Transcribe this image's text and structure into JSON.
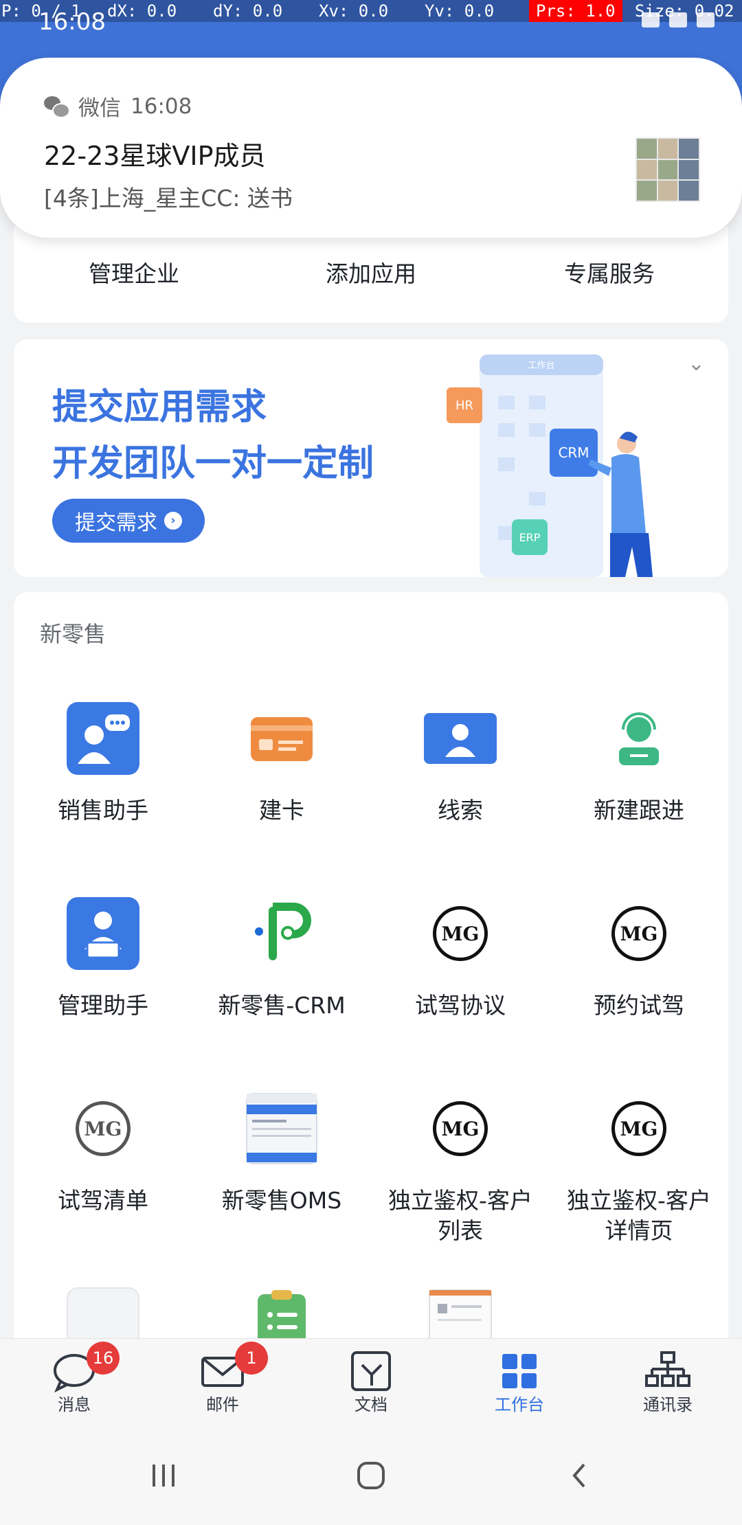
{
  "debug": {
    "p": "P: 0 / 1",
    "dx": "dX: 0.0",
    "dy": "dY: 0.0",
    "xv": "Xv: 0.0",
    "yv": "Yv: 0.0",
    "prs": "Prs: 1.0",
    "size": "Size: 0.02"
  },
  "status": {
    "time": "16:08"
  },
  "notification": {
    "app": "微信",
    "time": "16:08",
    "title": "22-23星球VIP成员",
    "body": "[4条]上海_星主CC: 送书"
  },
  "quick_actions": [
    "管理企业",
    "添加应用",
    "专属服务"
  ],
  "banner": {
    "line1": "提交应用需求",
    "line2": "开发团队一对一定制",
    "cta": "提交需求",
    "illu": {
      "header": "工作台",
      "hr": "HR",
      "crm": "CRM",
      "erp": "ERP"
    }
  },
  "apps": {
    "section_title": "新零售",
    "items": [
      "销售助手",
      "建卡",
      "线索",
      "新建跟进",
      "管理助手",
      "新零售-CRM",
      "试驾协议",
      "预约试驾",
      "试驾清单",
      "新零售OMS",
      "独立鉴权-客户\n列表",
      "独立鉴权-客户\n详情页"
    ]
  },
  "tabs": [
    {
      "label": "消息",
      "badge": "16"
    },
    {
      "label": "邮件",
      "badge": "1"
    },
    {
      "label": "文档",
      "badge": ""
    },
    {
      "label": "工作台",
      "badge": ""
    },
    {
      "label": "通讯录",
      "badge": ""
    }
  ],
  "colors": {
    "accent": "#3b74e0",
    "header": "#3f72d6",
    "badge": "#e63b3b"
  }
}
